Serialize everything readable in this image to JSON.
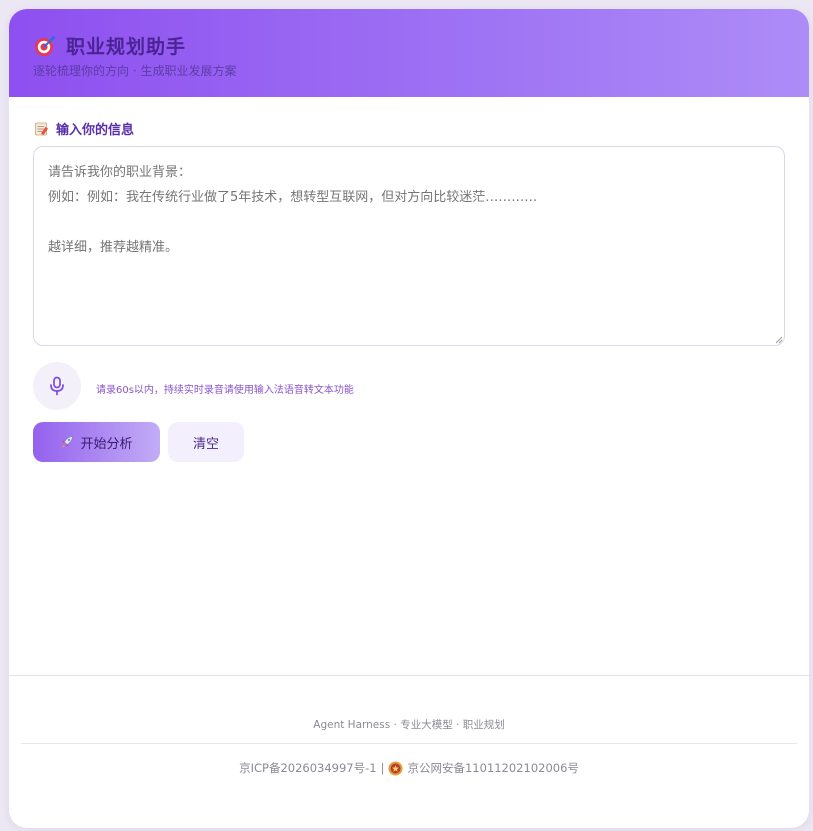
{
  "header": {
    "title": "职业规划助手",
    "subtitle": "逐轮梳理你的方向 · 生成职业发展方案",
    "icon": "target-dart-icon"
  },
  "input_section": {
    "label": "输入你的信息",
    "label_icon": "memo-icon",
    "placeholder": "请告诉我你的职业背景：\n例如：例如：我在传统行业做了5年技术，想转型互联网，但对方向比较迷茫…………\n\n越详细，推荐越精准。",
    "value": ""
  },
  "voice": {
    "icon": "microphone-icon",
    "hint": "请录60s以内，持续实时录音请使用输入法语音转文本功能"
  },
  "actions": {
    "analyze_label": "开始分析",
    "analyze_icon": "rocket-icon",
    "clear_label": "清空"
  },
  "footer": {
    "brand": "Agent Harness · 专业大模型 · 职业规划",
    "icp": "京ICP备2026034997号-1",
    "separator": "|",
    "police_record": "京公网安备11011202102006号",
    "police_icon": "police-badge-icon"
  },
  "colors": {
    "accent": "#8e4ff0",
    "title_text": "#4b2394",
    "label_text": "#5a2eaa"
  }
}
